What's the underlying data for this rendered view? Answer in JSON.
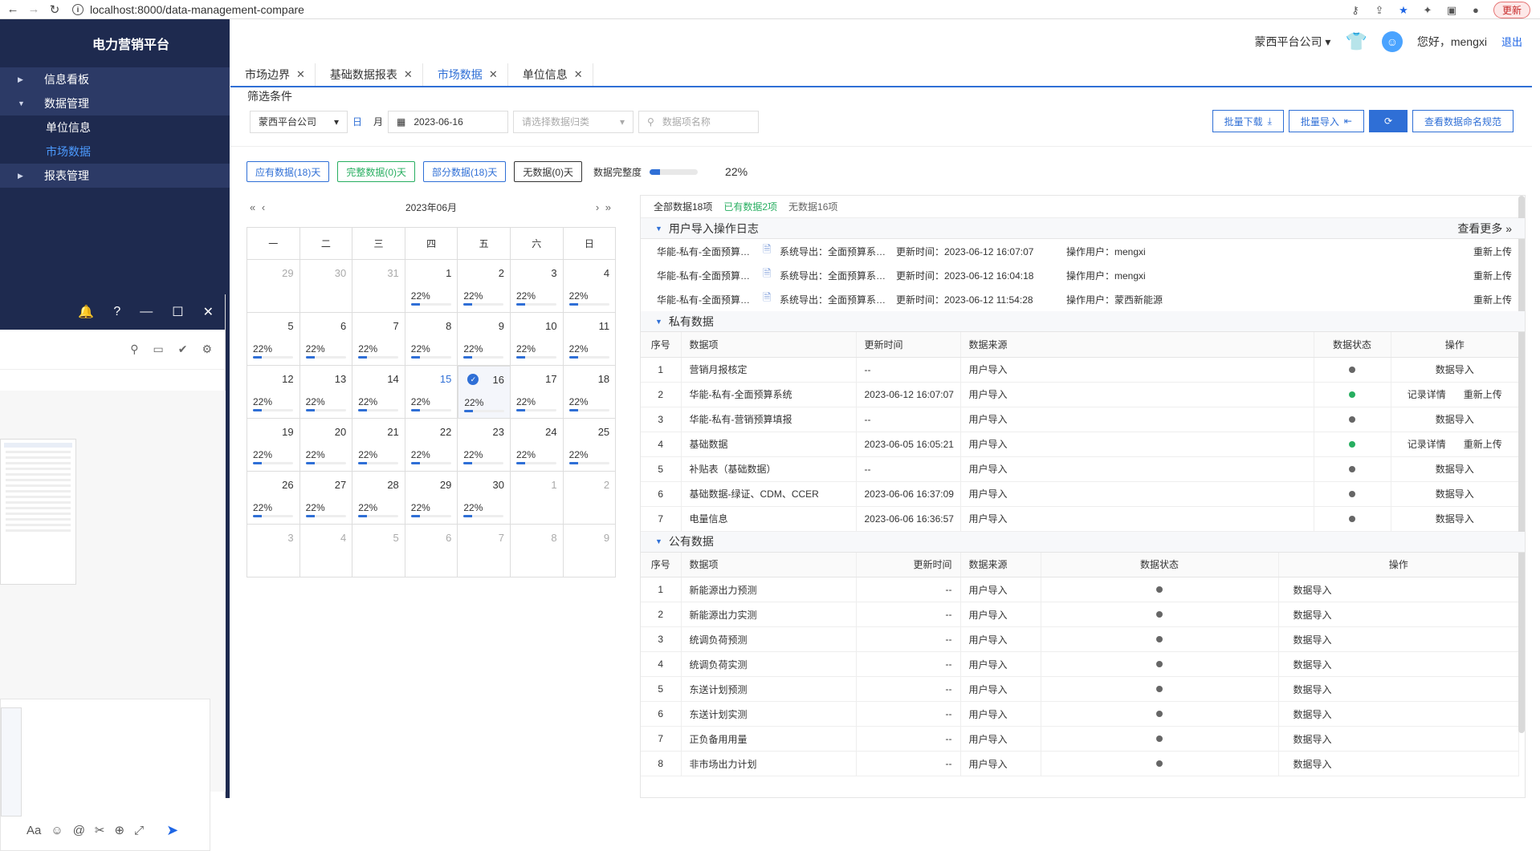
{
  "browser": {
    "url": "localhost:8000/data-management-compare",
    "update_label": "更新"
  },
  "sidebar": {
    "brand": "电力营销平台",
    "items": [
      {
        "label": "信息看板",
        "type": "group",
        "expanded": false
      },
      {
        "label": "数据管理",
        "type": "group",
        "expanded": true
      },
      {
        "label": "单位信息",
        "type": "sub",
        "active": false
      },
      {
        "label": "市场数据",
        "type": "sub",
        "active": true
      },
      {
        "label": "报表管理",
        "type": "group",
        "expanded": false
      }
    ]
  },
  "header": {
    "company": "蒙西平台公司",
    "greeting": "您好，mengxi",
    "logout": "退出"
  },
  "tabs": [
    {
      "label": "市场边界",
      "active": false
    },
    {
      "label": "基础数据报表",
      "active": false
    },
    {
      "label": "市场数据",
      "active": true
    },
    {
      "label": "单位信息",
      "active": false
    }
  ],
  "filter": {
    "title": "筛选条件",
    "company": "蒙西平台公司",
    "day_label": "日",
    "month_label": "月",
    "date": "2023-06-16",
    "category_placeholder": "请选择数据归类",
    "search_placeholder": "数据项名称"
  },
  "actions": {
    "batch_download": "批量下载",
    "batch_import": "批量导入",
    "view_naming": "查看数据命名规范"
  },
  "stats": {
    "due": "应有数据(18)天",
    "complete": "完整数据(0)天",
    "partial": "部分数据(18)天",
    "none": "无数据(0)天",
    "completeness_label": "数据完整度",
    "completeness_value": 22,
    "completeness_text": "22%"
  },
  "calendar": {
    "title": "2023年06月",
    "weekdays": [
      "一",
      "二",
      "三",
      "四",
      "五",
      "六",
      "日"
    ],
    "weeks": [
      [
        {
          "d": "29",
          "o": true
        },
        {
          "d": "30",
          "o": true
        },
        {
          "d": "31",
          "o": true
        },
        {
          "d": "1",
          "p": "22%"
        },
        {
          "d": "2",
          "p": "22%"
        },
        {
          "d": "3",
          "p": "22%"
        },
        {
          "d": "4",
          "p": "22%"
        }
      ],
      [
        {
          "d": "5",
          "p": "22%"
        },
        {
          "d": "6",
          "p": "22%"
        },
        {
          "d": "7",
          "p": "22%"
        },
        {
          "d": "8",
          "p": "22%"
        },
        {
          "d": "9",
          "p": "22%"
        },
        {
          "d": "10",
          "p": "22%"
        },
        {
          "d": "11",
          "p": "22%"
        }
      ],
      [
        {
          "d": "12",
          "p": "22%"
        },
        {
          "d": "13",
          "p": "22%"
        },
        {
          "d": "14",
          "p": "22%"
        },
        {
          "d": "15",
          "p": "22%",
          "today": true
        },
        {
          "d": "16",
          "p": "22%",
          "sel": true
        },
        {
          "d": "17",
          "p": "22%"
        },
        {
          "d": "18",
          "p": "22%"
        }
      ],
      [
        {
          "d": "19",
          "p": "22%"
        },
        {
          "d": "20",
          "p": "22%"
        },
        {
          "d": "21",
          "p": "22%"
        },
        {
          "d": "22",
          "p": "22%"
        },
        {
          "d": "23",
          "p": "22%"
        },
        {
          "d": "24",
          "p": "22%"
        },
        {
          "d": "25",
          "p": "22%"
        }
      ],
      [
        {
          "d": "26",
          "p": "22%"
        },
        {
          "d": "27",
          "p": "22%"
        },
        {
          "d": "28",
          "p": "22%"
        },
        {
          "d": "29",
          "p": "22%"
        },
        {
          "d": "30",
          "p": "22%"
        },
        {
          "d": "1",
          "o": true
        },
        {
          "d": "2",
          "o": true
        }
      ],
      [
        {
          "d": "3",
          "o": true
        },
        {
          "d": "4",
          "o": true
        },
        {
          "d": "5",
          "o": true
        },
        {
          "d": "6",
          "o": true
        },
        {
          "d": "7",
          "o": true
        },
        {
          "d": "8",
          "o": true
        },
        {
          "d": "9",
          "o": true
        }
      ]
    ]
  },
  "summary": {
    "all": "全部数据18项",
    "has": "已有数据2项",
    "none": "无数据16项"
  },
  "import_log": {
    "title": "用户导入操作日志",
    "more": "查看更多",
    "rows": [
      {
        "item": "华能-私有-全面预算…",
        "source": "系统导出：全面预算系…",
        "time": "更新时间：2023-06-12 16:07:07",
        "user": "操作用户：mengxi",
        "action": "重新上传"
      },
      {
        "item": "华能-私有-全面预算…",
        "source": "系统导出：全面预算系…",
        "time": "更新时间：2023-06-12 16:04:18",
        "user": "操作用户：mengxi",
        "action": "重新上传"
      },
      {
        "item": "华能-私有-全面预算…",
        "source": "系统导出：全面预算系…",
        "time": "更新时间：2023-06-12 11:54:28",
        "user": "操作用户：蒙西新能源",
        "action": "重新上传"
      }
    ]
  },
  "private": {
    "title": "私有数据",
    "columns": [
      "序号",
      "数据项",
      "更新时间",
      "数据来源",
      "数据状态",
      "操作"
    ],
    "rows": [
      {
        "no": "1",
        "item": "营销月报核定",
        "time": "--",
        "source": "用户导入",
        "status": "gray",
        "ops": [
          "数据导入"
        ]
      },
      {
        "no": "2",
        "item": "华能-私有-全面预算系统",
        "time": "2023-06-12 16:07:07",
        "source": "用户导入",
        "status": "green",
        "ops": [
          "记录详情",
          "重新上传"
        ]
      },
      {
        "no": "3",
        "item": "华能-私有-营销预算填报",
        "time": "--",
        "source": "用户导入",
        "status": "gray",
        "ops": [
          "数据导入"
        ]
      },
      {
        "no": "4",
        "item": "基础数据",
        "time": "2023-06-05 16:05:21",
        "source": "用户导入",
        "status": "green",
        "ops": [
          "记录详情",
          "重新上传"
        ]
      },
      {
        "no": "5",
        "item": "补贴表（基础数据）",
        "time": "--",
        "source": "用户导入",
        "status": "gray",
        "ops": [
          "数据导入"
        ]
      },
      {
        "no": "6",
        "item": "基础数据-绿证、CDM、CCER",
        "time": "2023-06-06 16:37:09",
        "source": "用户导入",
        "status": "gray",
        "ops": [
          "数据导入"
        ]
      },
      {
        "no": "7",
        "item": "电量信息",
        "time": "2023-06-06 16:36:57",
        "source": "用户导入",
        "status": "gray",
        "ops": [
          "数据导入"
        ]
      }
    ]
  },
  "public": {
    "title": "公有数据",
    "columns": [
      "序号",
      "数据项",
      "更新时间",
      "数据来源",
      "数据状态",
      "操作"
    ],
    "rows": [
      {
        "no": "1",
        "item": "新能源出力预测",
        "time": "--",
        "source": "用户导入",
        "op": "数据导入"
      },
      {
        "no": "2",
        "item": "新能源出力实测",
        "time": "--",
        "source": "用户导入",
        "op": "数据导入"
      },
      {
        "no": "3",
        "item": "统调负荷预测",
        "time": "--",
        "source": "用户导入",
        "op": "数据导入"
      },
      {
        "no": "4",
        "item": "统调负荷实测",
        "time": "--",
        "source": "用户导入",
        "op": "数据导入"
      },
      {
        "no": "5",
        "item": "东送计划预测",
        "time": "--",
        "source": "用户导入",
        "op": "数据导入"
      },
      {
        "no": "6",
        "item": "东送计划实测",
        "time": "--",
        "source": "用户导入",
        "op": "数据导入"
      },
      {
        "no": "7",
        "item": "正负备用用量",
        "time": "--",
        "source": "用户导入",
        "op": "数据导入"
      },
      {
        "no": "8",
        "item": "非市场出力计划",
        "time": "--",
        "source": "用户导入",
        "op": "数据导入"
      }
    ]
  },
  "colors": {
    "accent": "#2f6fd6",
    "sidebar": "#1e2a4f",
    "ok": "#27ae60"
  }
}
